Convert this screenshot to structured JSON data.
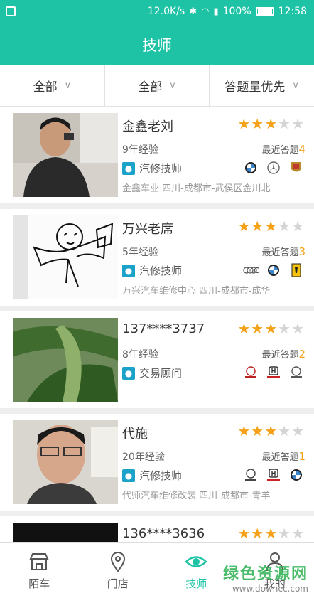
{
  "statusbar": {
    "net_speed": "12.0K/s",
    "battery": "100%",
    "time": "12:58"
  },
  "title": "技师",
  "filters": [
    {
      "label": "全部"
    },
    {
      "label": "全部"
    },
    {
      "label": "答题量优先"
    }
  ],
  "list_items": [
    {
      "name": "金鑫老刘",
      "experience": "9年经验",
      "answers_label": "最近答题",
      "answers_count": "4",
      "role": "汽修技师",
      "rating": 3,
      "brands": [
        "bmw-logo",
        "mercedes-logo",
        "porsche-logo"
      ],
      "address": "金鑫车业 四川-成都市-武侯区金川北"
    },
    {
      "name": "万兴老席",
      "experience": "5年经验",
      "answers_label": "最近答题",
      "answers_count": "3",
      "role": "汽修技师",
      "rating": 3,
      "brands": [
        "audi-logo",
        "bmw-logo",
        "ferrari-logo"
      ],
      "address": "万兴汽车维修中心 四川-成都市-成华"
    },
    {
      "name": "137****3737",
      "experience": "8年经验",
      "answers_label": "最近答题",
      "answers_count": "2",
      "role": "交易顾问",
      "rating": 3,
      "brands": [
        "buick-logo",
        "honda-logo",
        "buick-logo"
      ],
      "address": ""
    },
    {
      "name": "代施",
      "experience": "20年经验",
      "answers_label": "最近答题",
      "answers_count": "1",
      "role": "汽修技师",
      "rating": 3,
      "brands": [
        "buick-logo",
        "honda-logo",
        "bmw-logo"
      ],
      "address": "代师汽车维修改装 四川-成都市-青羊"
    },
    {
      "name": "136****3636",
      "experience": "",
      "answers_label": "",
      "answers_count": "",
      "role": "",
      "rating": 3,
      "brands": [],
      "address": ""
    }
  ],
  "tabs": [
    {
      "label": "陌车",
      "icon": "shop-icon",
      "active": false
    },
    {
      "label": "门店",
      "icon": "location-pin-icon",
      "active": false
    },
    {
      "label": "技师",
      "icon": "eye-icon",
      "active": true
    },
    {
      "label": "我的",
      "icon": "user-icon",
      "active": false
    }
  ],
  "watermark": {
    "main": "绿色资源网",
    "url": "www.downcc.com"
  },
  "colors": {
    "accent": "#1ec3a6",
    "star": "#f5a117",
    "role_icon": "#1ba2c9"
  }
}
